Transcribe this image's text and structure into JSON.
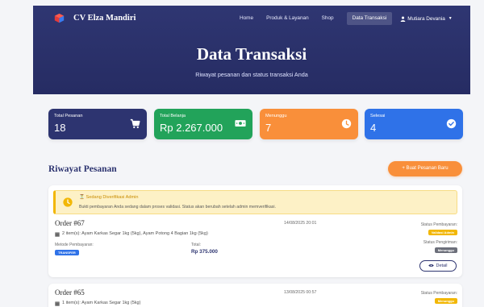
{
  "nav": {
    "brand": "CV Elza Mandiri",
    "links": [
      "Home",
      "Produk & Layanan",
      "Shop",
      "Data Transaksi"
    ],
    "user": "Mutiara Devania"
  },
  "hero": {
    "title": "Data Transaksi",
    "subtitle": "Riwayat pesanan dan status transaksi Anda"
  },
  "stats": [
    {
      "label": "Total Pesanan",
      "value": "18",
      "icon": "cart-icon",
      "color": "#2d3470"
    },
    {
      "label": "Total Belanja",
      "value": "Rp 2.267.000",
      "icon": "cash-icon",
      "color": "#22a35a"
    },
    {
      "label": "Menunggu",
      "value": "7",
      "icon": "clock-icon",
      "color": "#f98f3a"
    },
    {
      "label": "Selesai",
      "value": "4",
      "icon": "check-circle-icon",
      "color": "#2f72e8"
    }
  ],
  "section": {
    "title": "Riwayat Pesanan",
    "new_order_label": "+ Buat Pesanan Baru"
  },
  "orders": [
    {
      "alert_title": "Sedang Diverifikasi Admin",
      "alert_text": "Bukti pembayaran Anda sedang dalam proses validasi. Status akan berubah setelah admin memverifikasi.",
      "id": "Order #67",
      "date": "14/08/2025 20:01",
      "items": "2 item(s): Ayam Karkas Segar 1kg (5kg), Ayam Potong 4 Bagian 1kg (5kg)",
      "payment_method_label": "Metode Pembayaran:",
      "payment_method": "TRANSFER",
      "total_label": "Total:",
      "total": "Rp 375.000",
      "payment_status_label": "Status Pembayaran:",
      "payment_status": "Validasi Admin",
      "shipping_status_label": "Status Pengiriman:",
      "shipping_status": "Menunggu",
      "detail_label": "Detail"
    },
    {
      "id": "Order #65",
      "date": "13/08/2025 00:57",
      "items": "1 item(s): Ayam Karkas Segar 1kg (5kg)",
      "payment_status_label": "Status Pembayaran:",
      "payment_status": "Menunggu"
    }
  ]
}
